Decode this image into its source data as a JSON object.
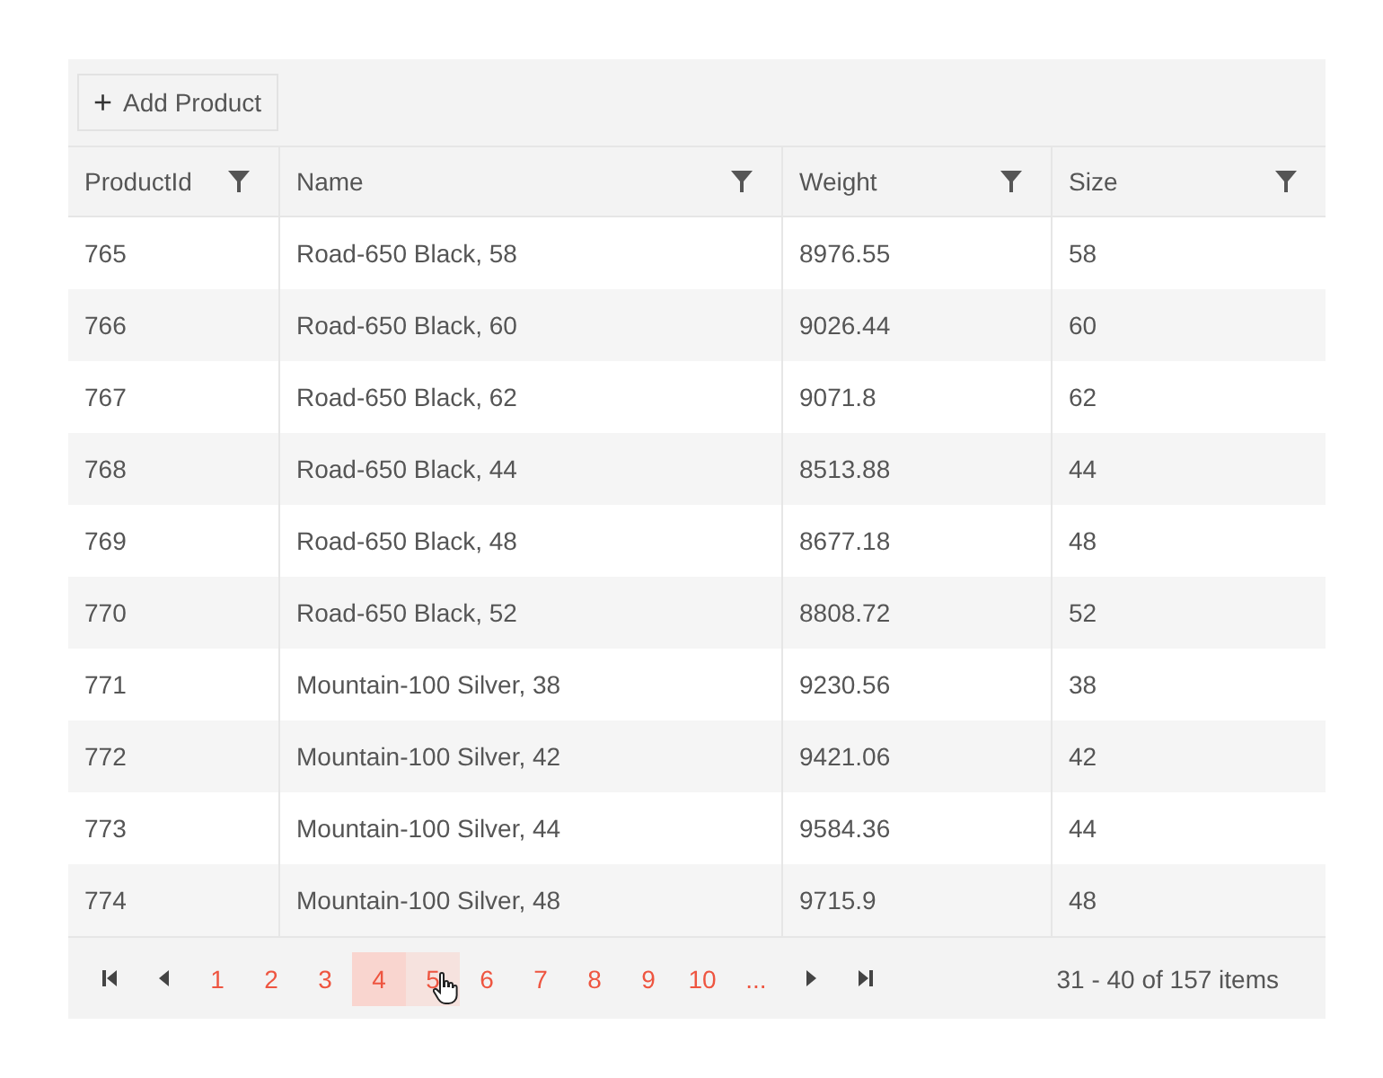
{
  "toolbar": {
    "add_button": {
      "icon": "+",
      "label": "Add Product"
    }
  },
  "table": {
    "columns": [
      "ProductId",
      "Name",
      "Weight",
      "Size"
    ],
    "rows": [
      [
        "765",
        "Road-650 Black, 58",
        "8976.55",
        "58"
      ],
      [
        "766",
        "Road-650 Black, 60",
        "9026.44",
        "60"
      ],
      [
        "767",
        "Road-650 Black, 62",
        "9071.8",
        "62"
      ],
      [
        "768",
        "Road-650 Black, 44",
        "8513.88",
        "44"
      ],
      [
        "769",
        "Road-650 Black, 48",
        "8677.18",
        "48"
      ],
      [
        "770",
        "Road-650 Black, 52",
        "8808.72",
        "52"
      ],
      [
        "771",
        "Mountain-100 Silver, 38",
        "9230.56",
        "38"
      ],
      [
        "772",
        "Mountain-100 Silver, 42",
        "9421.06",
        "42"
      ],
      [
        "773",
        "Mountain-100 Silver, 44",
        "9584.36",
        "44"
      ],
      [
        "774",
        "Mountain-100 Silver, 48",
        "9715.9",
        "48"
      ]
    ]
  },
  "pager": {
    "pages": [
      {
        "label": "1",
        "selected": false,
        "hovered": false
      },
      {
        "label": "2",
        "selected": false,
        "hovered": false
      },
      {
        "label": "3",
        "selected": false,
        "hovered": false
      },
      {
        "label": "4",
        "selected": true,
        "hovered": false
      },
      {
        "label": "5",
        "selected": false,
        "hovered": true
      },
      {
        "label": "6",
        "selected": false,
        "hovered": false
      },
      {
        "label": "7",
        "selected": false,
        "hovered": false
      },
      {
        "label": "8",
        "selected": false,
        "hovered": false
      },
      {
        "label": "9",
        "selected": false,
        "hovered": false
      },
      {
        "label": "10",
        "selected": false,
        "hovered": false
      },
      {
        "label": "...",
        "selected": false,
        "hovered": false
      }
    ],
    "info": "31 - 40 of 157 items"
  }
}
